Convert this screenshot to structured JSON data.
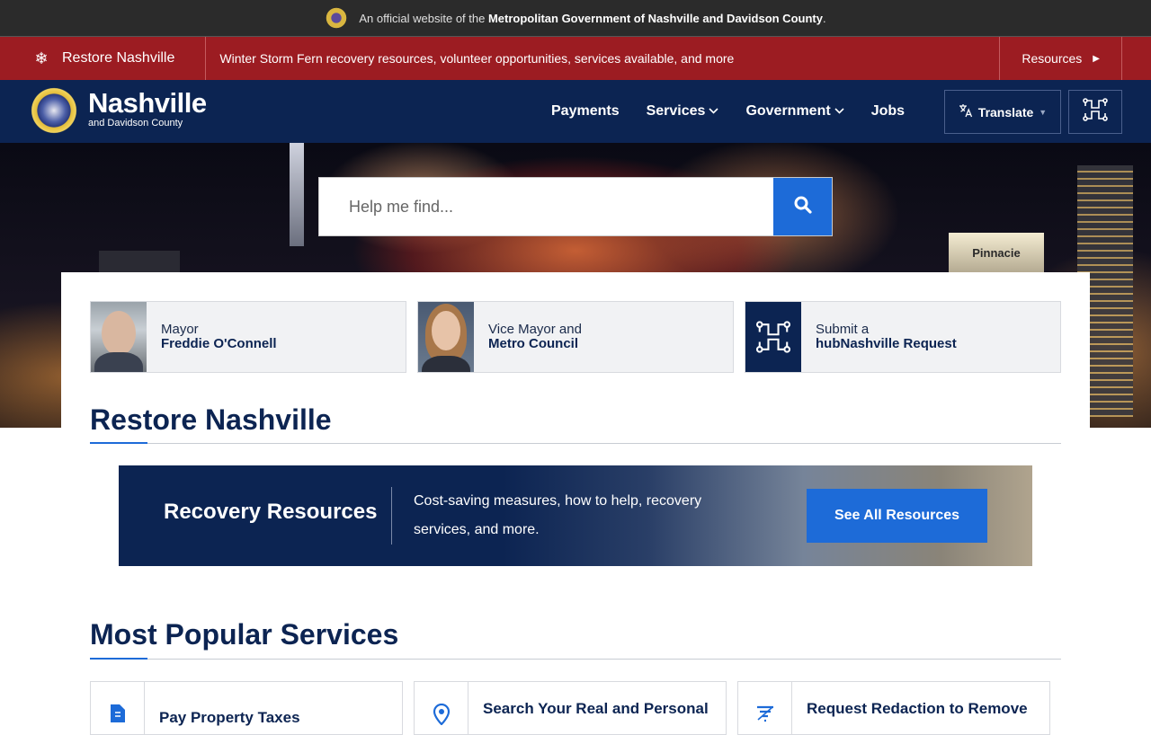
{
  "official_banner": {
    "prefix": "An official website of the",
    "org": "Metropolitan Government of Nashville and Davidson County",
    "suffix": "."
  },
  "alert": {
    "title": "Restore Nashville",
    "message": "Winter Storm Fern recovery resources, volunteer opportunities, services available, and more",
    "resources_label": "Resources"
  },
  "header": {
    "brand_name": "Nashville",
    "brand_sub": "and Davidson County",
    "nav": [
      {
        "label": "Payments",
        "dropdown": false
      },
      {
        "label": "Services",
        "dropdown": true
      },
      {
        "label": "Government",
        "dropdown": true
      },
      {
        "label": "Jobs",
        "dropdown": false
      }
    ],
    "translate_label": "Translate"
  },
  "hero": {
    "search_placeholder": "Help me find...",
    "building_sign": "Pinnacie"
  },
  "quick_cards": [
    {
      "line1": "Mayor",
      "line2": "Freddie O'Connell"
    },
    {
      "line1": "Vice Mayor and",
      "line2": "Metro Council"
    },
    {
      "line1": "Submit a",
      "line2": "hubNashville Request"
    }
  ],
  "restore_section": {
    "title": "Restore Nashville",
    "banner_title": "Recovery Resources",
    "banner_desc": "Cost-saving measures, how to help, recovery services, and more.",
    "button_label": "See All Resources"
  },
  "popular_section": {
    "title": "Most Popular Services",
    "services": [
      {
        "label": "Pay Property Taxes",
        "icon": "document-dollar-icon"
      },
      {
        "label": "Search Your Real and Personal",
        "icon": "map-pin-icon"
      },
      {
        "label": "Request Redaction to Remove",
        "icon": "filter-list-icon"
      }
    ]
  },
  "colors": {
    "navy": "#0c2452",
    "alert_red": "#9c1c22",
    "accent_blue": "#1d6bd8"
  }
}
